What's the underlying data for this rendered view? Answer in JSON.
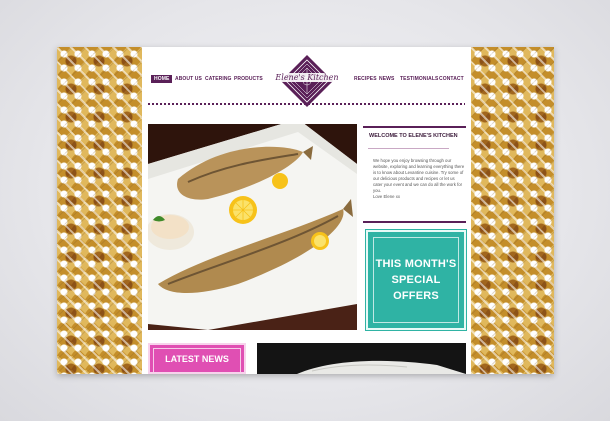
{
  "brand": {
    "name": "Elene's Kitchen",
    "accent": "#5a2058",
    "teal": "#2fb3a4",
    "pink": "#e04fb3"
  },
  "nav": {
    "items": [
      {
        "label": "HOME",
        "active": true
      },
      {
        "label": "ABOUT US"
      },
      {
        "label": "CATERING"
      },
      {
        "label": "PRODUCTS"
      },
      {
        "label": "RECIPES"
      },
      {
        "label": "NEWS"
      },
      {
        "label": "TESTIMONIALS"
      },
      {
        "label": "CONTACT"
      }
    ]
  },
  "welcome": {
    "title": "WELCOME TO ELENE'S KITCHEN",
    "body": "We hope you enjoy browsing through our website, exploring and learning everything there is to know about Levantine cuisine. Try some of our delicious products and recipes or let us cater your event and we can do all the work for you.",
    "signoff": "Love Elene xx"
  },
  "offers": {
    "line1": "THIS MONTH'S",
    "line2": "SPECIAL OFFERS"
  },
  "news": {
    "label": "LATEST NEWS"
  },
  "icons": {
    "logo": "diamond-logo-icon",
    "hero": "grilled-fish-photo",
    "photo2": "plate-photo"
  }
}
